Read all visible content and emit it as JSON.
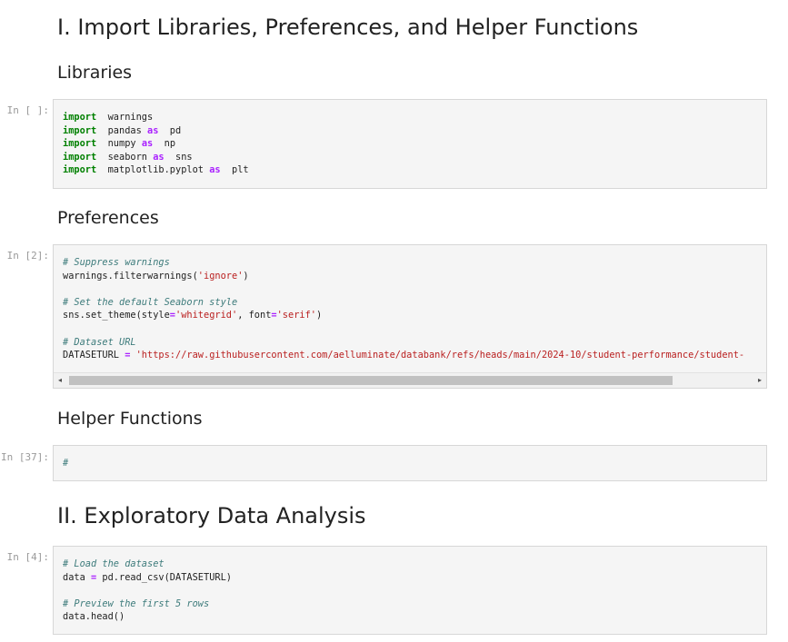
{
  "sections": {
    "import_heading": "I. Import Libraries, Preferences, and Helper Functions",
    "libraries_heading": "Libraries",
    "preferences_heading": "Preferences",
    "helper_heading": "Helper Functions",
    "eda_heading": "II. Exploratory Data Analysis"
  },
  "cells": [
    {
      "prompt": "In [ ]:",
      "lines": [
        [
          [
            "kw",
            "import"
          ],
          [
            "",
            "  warnings"
          ]
        ],
        [
          [
            "kw",
            "import"
          ],
          [
            "",
            "  pandas "
          ],
          [
            "op",
            "as"
          ],
          [
            "",
            "  pd"
          ]
        ],
        [
          [
            "kw",
            "import"
          ],
          [
            "",
            "  numpy "
          ],
          [
            "op",
            "as"
          ],
          [
            "",
            "  np"
          ]
        ],
        [
          [
            "kw",
            "import"
          ],
          [
            "",
            "  seaborn "
          ],
          [
            "op",
            "as"
          ],
          [
            "",
            "  sns"
          ]
        ],
        [
          [
            "kw",
            "import"
          ],
          [
            "",
            "  matplotlib.pyplot "
          ],
          [
            "op",
            "as"
          ],
          [
            "",
            "  plt"
          ]
        ]
      ]
    },
    {
      "prompt": "In [2]:",
      "lines": [
        [
          [
            "cm",
            "# Suppress warnings"
          ]
        ],
        [
          [
            "",
            "warnings.filterwarnings("
          ],
          [
            "st",
            "'ignore'"
          ],
          [
            "",
            ")"
          ]
        ],
        [],
        [
          [
            "cm",
            "# Set the default Seaborn style"
          ]
        ],
        [
          [
            "",
            "sns.set_theme(style"
          ],
          [
            "op",
            "="
          ],
          [
            "st",
            "'whitegrid'"
          ],
          [
            "",
            ", font"
          ],
          [
            "op",
            "="
          ],
          [
            "st",
            "'serif'"
          ],
          [
            "",
            ")"
          ]
        ],
        [],
        [
          [
            "cm",
            "# Dataset URL"
          ]
        ],
        [
          [
            "",
            "DATASETURL "
          ],
          [
            "op",
            "="
          ],
          [
            "",
            " "
          ],
          [
            "st",
            "'https://raw.githubusercontent.com/aelluminate/databank/refs/heads/main/2024-10/student-performance/student-"
          ]
        ]
      ]
    },
    {
      "prompt": "In [37]:",
      "lines": [
        [
          [
            "cm",
            "#"
          ]
        ]
      ]
    },
    {
      "prompt": "In [4]:",
      "lines": [
        [
          [
            "cm",
            "# Load the dataset"
          ]
        ],
        [
          [
            "",
            "data "
          ],
          [
            "op",
            "="
          ],
          [
            "",
            " pd.read_csv(DATASETURL)"
          ]
        ],
        [],
        [
          [
            "cm",
            "# Preview the first 5 rows"
          ]
        ],
        [
          [
            "",
            "data.head()"
          ]
        ]
      ]
    }
  ],
  "scrollbar": {
    "left_arrow": "◂",
    "right_arrow": "▸"
  }
}
